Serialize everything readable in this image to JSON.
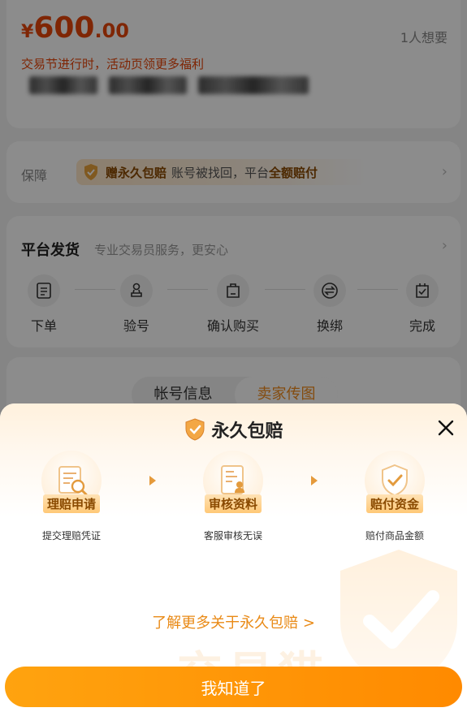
{
  "price": {
    "symbol": "¥",
    "integer": "600",
    "decimal": ".00"
  },
  "wants_count": "1人想要",
  "promo_text": "交易节进行时，活动页领更多福利",
  "guarantee": {
    "label": "保障",
    "badge": "赠永久包赔",
    "text_before": "账号被找回，平台",
    "text_bold": "全额赔付"
  },
  "shipping": {
    "title": "平台发货",
    "subtitle": "专业交易员服务，更安心",
    "steps": [
      {
        "label": "下单",
        "icon": "order-icon"
      },
      {
        "label": "验号",
        "icon": "verify-icon"
      },
      {
        "label": "确认购买",
        "icon": "confirm-icon"
      },
      {
        "label": "换绑",
        "icon": "rebind-icon"
      },
      {
        "label": "完成",
        "icon": "complete-icon"
      }
    ]
  },
  "tabs": [
    "帐号信息",
    "卖家传图"
  ],
  "sheet": {
    "title": "永久包赔",
    "steps": [
      {
        "tag": "理赔申请",
        "desc": "提交理赔凭证",
        "icon": "document-search-icon"
      },
      {
        "tag": "审核资料",
        "desc": "客服审核无误",
        "icon": "id-card-icon"
      },
      {
        "tag": "赔付资金",
        "desc": "赔付商品金额",
        "icon": "shield-check-icon"
      }
    ],
    "learn_more": "了解更多关于永久包赔 >",
    "watermark": "交易猫",
    "button": "我知道了"
  },
  "colors": {
    "accent": "#ff9500",
    "price": "#e8450a",
    "link": "#e98a16"
  }
}
